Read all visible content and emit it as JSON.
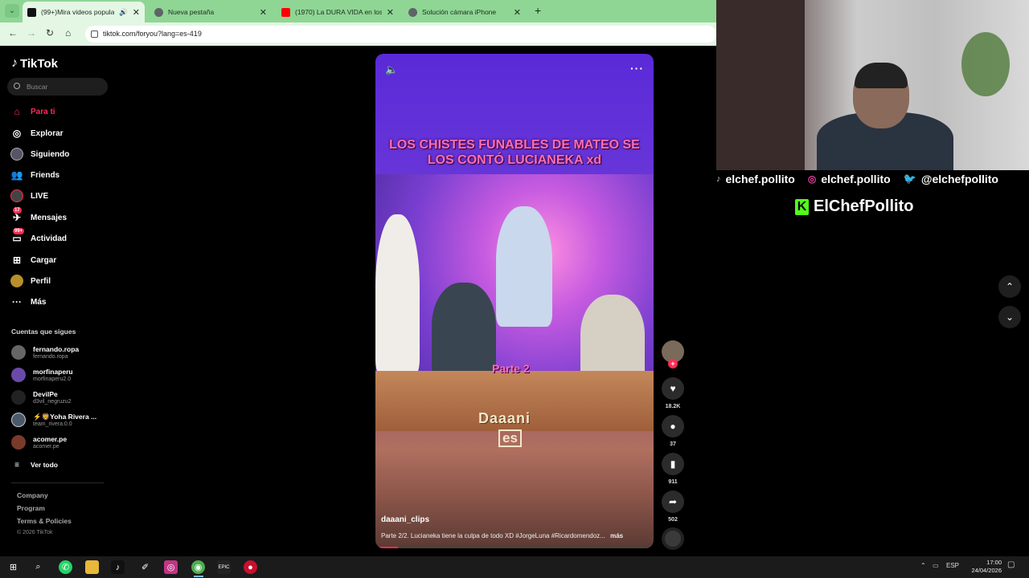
{
  "browser": {
    "tabs": [
      {
        "title": "(99+)Mira videos populare",
        "active": true,
        "favicon_color": "#111111"
      },
      {
        "title": "Nueva pestaña",
        "active": false,
        "favicon_color": "#5f6368"
      },
      {
        "title": "(1970) La DURA VIDA en los PU",
        "active": false,
        "favicon_color": "#ff0000"
      },
      {
        "title": "Solución cámara iPhone",
        "active": false,
        "favicon_color": "#5f6368"
      }
    ],
    "url": "tiktok.com/foryou?lang=es-419"
  },
  "tiktok": {
    "logo": "TikTok",
    "search_placeholder": "Buscar",
    "nav": [
      {
        "label": "Para ti",
        "icon": "home-icon",
        "active": true
      },
      {
        "label": "Explorar",
        "icon": "compass-icon"
      },
      {
        "label": "Siguiendo",
        "icon": "following-avatar-icon"
      },
      {
        "label": "Friends",
        "icon": "friends-icon"
      },
      {
        "label": "LIVE",
        "icon": "live-icon"
      },
      {
        "label": "Mensajes",
        "icon": "message-icon",
        "badge": "17"
      },
      {
        "label": "Actividad",
        "icon": "inbox-icon",
        "badge": "99+"
      },
      {
        "label": "Cargar",
        "icon": "upload-icon"
      },
      {
        "label": "Perfil",
        "icon": "profile-icon"
      },
      {
        "label": "Más",
        "icon": "more-icon"
      }
    ],
    "following_title": "Cuentas que sigues",
    "following": [
      {
        "name": "fernando.ropa",
        "handle": "fernando.ropa"
      },
      {
        "name": "morfinaperu",
        "handle": "morfinaperu2.0"
      },
      {
        "name": "DevilPe",
        "handle": "d3vil_negruzu2"
      },
      {
        "name": "⚡🦁Yoha Rivera ...",
        "handle": "team_rivera.0.0"
      },
      {
        "name": "acomer.pe",
        "handle": "acomer.pe"
      }
    ],
    "see_all": "Ver todo",
    "footer": [
      "Company",
      "Program",
      "Terms & Policies"
    ],
    "copyright": "© 2026 TikTok"
  },
  "video": {
    "headline_line1": "LOS CHISTES FUNABLES DE MATEO SE",
    "headline_line2": "LOS CONTÓ LUCIANEKA xd",
    "part_label": "Parte 2",
    "watermark_line1": "Daaani",
    "watermark_line2": "es",
    "author": "daaani_clips",
    "description": "Parte 2/2. Lucianeka tiene la culpa de todo XD #JorgeLuna #Ricardomendoz...",
    "more_label": "más",
    "progress": 0.08
  },
  "actions": {
    "likes": "18.2K",
    "comments": "37",
    "saves": "911",
    "shares": "502"
  },
  "overlay": {
    "socials": [
      {
        "icon": "tiktok-icon",
        "text": "elchef.pollito"
      },
      {
        "icon": "instagram-icon",
        "text": "elchef.pollito"
      },
      {
        "icon": "twitter-icon",
        "text": "@elchefpollito"
      }
    ],
    "kick_name": "ElChefPollito"
  },
  "taskbar": {
    "lang": "ESP",
    "time": "17:00",
    "date": "24/04/2026"
  }
}
